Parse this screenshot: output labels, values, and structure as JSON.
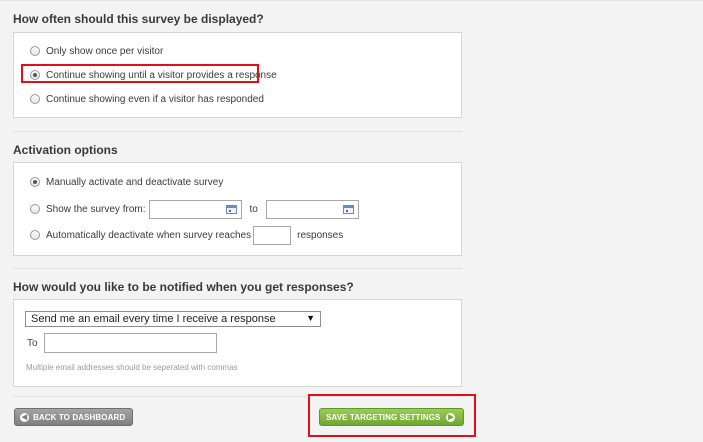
{
  "display_section": {
    "title": "How often should this survey be displayed?",
    "options": [
      {
        "label": "Only show once per visitor",
        "checked": false
      },
      {
        "label": "Continue showing until a visitor provides a response",
        "checked": true
      },
      {
        "label": "Continue showing even if a visitor has responded",
        "checked": false
      }
    ]
  },
  "activation_section": {
    "title": "Activation options",
    "manual_label": "Manually activate and deactivate survey",
    "show_from_label": "Show the survey from:",
    "to_label": "to",
    "auto_label": "Automatically deactivate when survey reaches",
    "responses_label": "responses",
    "selected": "manual"
  },
  "notify_section": {
    "title": "How would you like to be notified when you get responses?",
    "select_value": "Send me an email every time I receive a response",
    "to_label": "To",
    "email_value": "",
    "hint": "Multiple email addresses should be seperated with commas"
  },
  "buttons": {
    "back_label": "BACK TO DASHBOARD",
    "save_label": "SAVE TARGETING SETTINGS"
  },
  "colors": {
    "highlight": "#e0101b",
    "save_button": "#7ab83f",
    "back_button": "#8e8e8e"
  }
}
